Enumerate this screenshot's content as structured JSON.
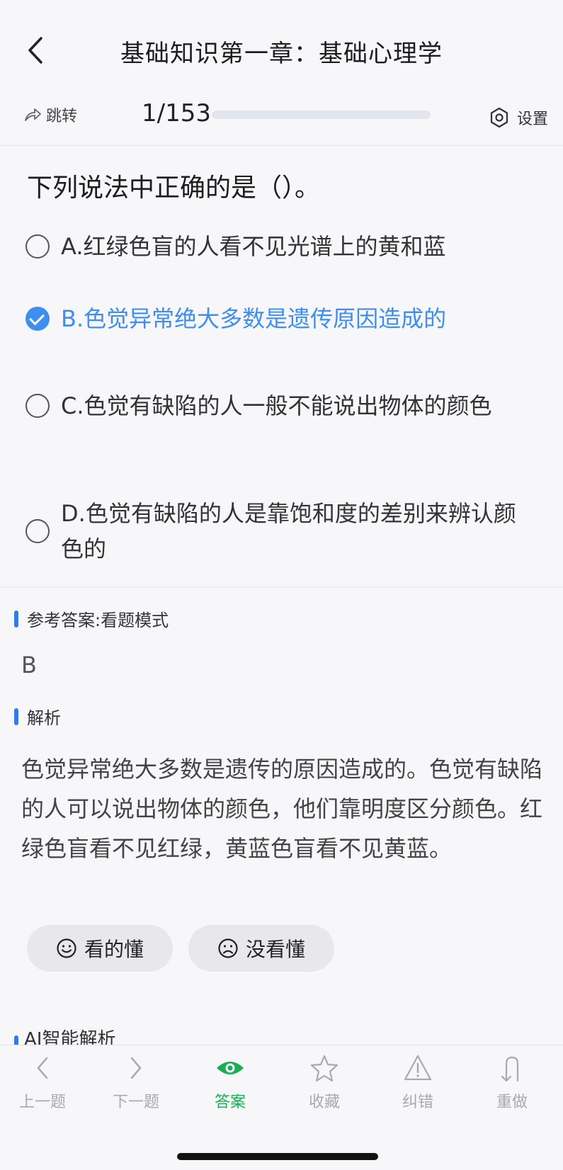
{
  "header": {
    "title": "基础知识第一章：基础心理学"
  },
  "toolbar": {
    "jump_label": "跳转",
    "counter": "1/153",
    "progress": 0.0065,
    "settings_label": "设置"
  },
  "question": {
    "text": "下列说法中正确的是（）。",
    "options": [
      {
        "label": "A.红绿色盲的人看不见光谱上的黄和蓝",
        "selected": false
      },
      {
        "label": "B.色觉异常绝大多数是遗传原因造成的",
        "selected": true
      },
      {
        "label": "C.色觉有缺陷的人一般不能说出物体的颜色",
        "selected": false
      },
      {
        "label": "D.色觉有缺陷的人是靠饱和度的差别来辨认颜色的",
        "selected": false
      }
    ]
  },
  "answer": {
    "section_label": "参考答案:看题模式",
    "value": "B"
  },
  "analysis": {
    "section_label": "解析",
    "text": "色觉异常绝大多数是遗传的原因造成的。色觉有缺陷的人可以说出物体的颜色，他们靠明度区分颜色。红绿色盲看不见红绿，黄蓝色盲看不见黄蓝。"
  },
  "feedback": {
    "understood_label": "看的懂",
    "not_understood_label": "没看懂"
  },
  "ai": {
    "section_label": "AI智能解析"
  },
  "nav": {
    "prev": "上一题",
    "next": "下一题",
    "answer": "答案",
    "favorite": "收藏",
    "report": "纠错",
    "redo": "重做"
  },
  "colors": {
    "accent": "#3d8ef0",
    "active_green": "#1aae55",
    "section_bar": "#2f7bea"
  }
}
